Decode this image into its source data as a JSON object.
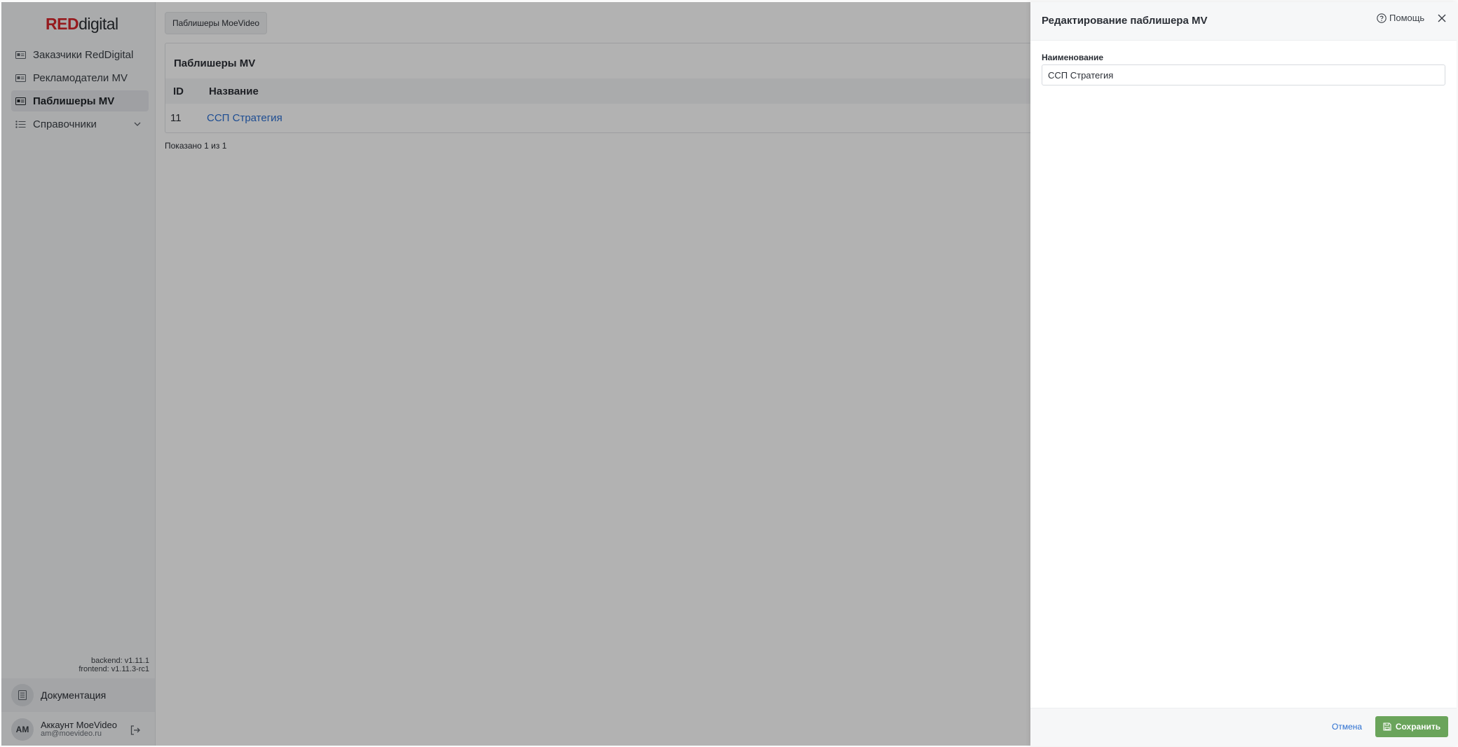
{
  "sidebar": {
    "logo": {
      "red": "RED",
      "rest": "digital"
    },
    "items": [
      {
        "label": "Заказчики RedDigital",
        "active": false
      },
      {
        "label": "Рекламодатели MV",
        "active": false
      },
      {
        "label": "Паблишеры MV",
        "active": true
      },
      {
        "label": "Справочники",
        "active": false,
        "expandable": true
      }
    ],
    "versions": {
      "backend": "backend: v1.11.1",
      "frontend": "frontend: v1.11.3-rc1"
    },
    "docs_label": "Документация",
    "account": {
      "initials": "AM",
      "name": "Аккаунт MoeVideo",
      "email": "am@moevideo.ru"
    }
  },
  "main": {
    "breadcrumb": "Паблишеры MoeVideo",
    "card_title": "Паблишеры MV",
    "columns": {
      "id": "ID",
      "name": "Название"
    },
    "rows": [
      {
        "id": "11",
        "name": "ССП Стратегия"
      }
    ],
    "shown_text": "Показано 1 из 1"
  },
  "drawer": {
    "title": "Редактирование паблишера MV",
    "help_label": "Помощь",
    "field_label": "Наименование",
    "field_value": "ССП Стратегия",
    "cancel_label": "Отмена",
    "save_label": "Сохранить"
  },
  "colors": {
    "brand_red": "#d7262c",
    "link": "#2b6fd1",
    "save": "#6aa45b"
  }
}
